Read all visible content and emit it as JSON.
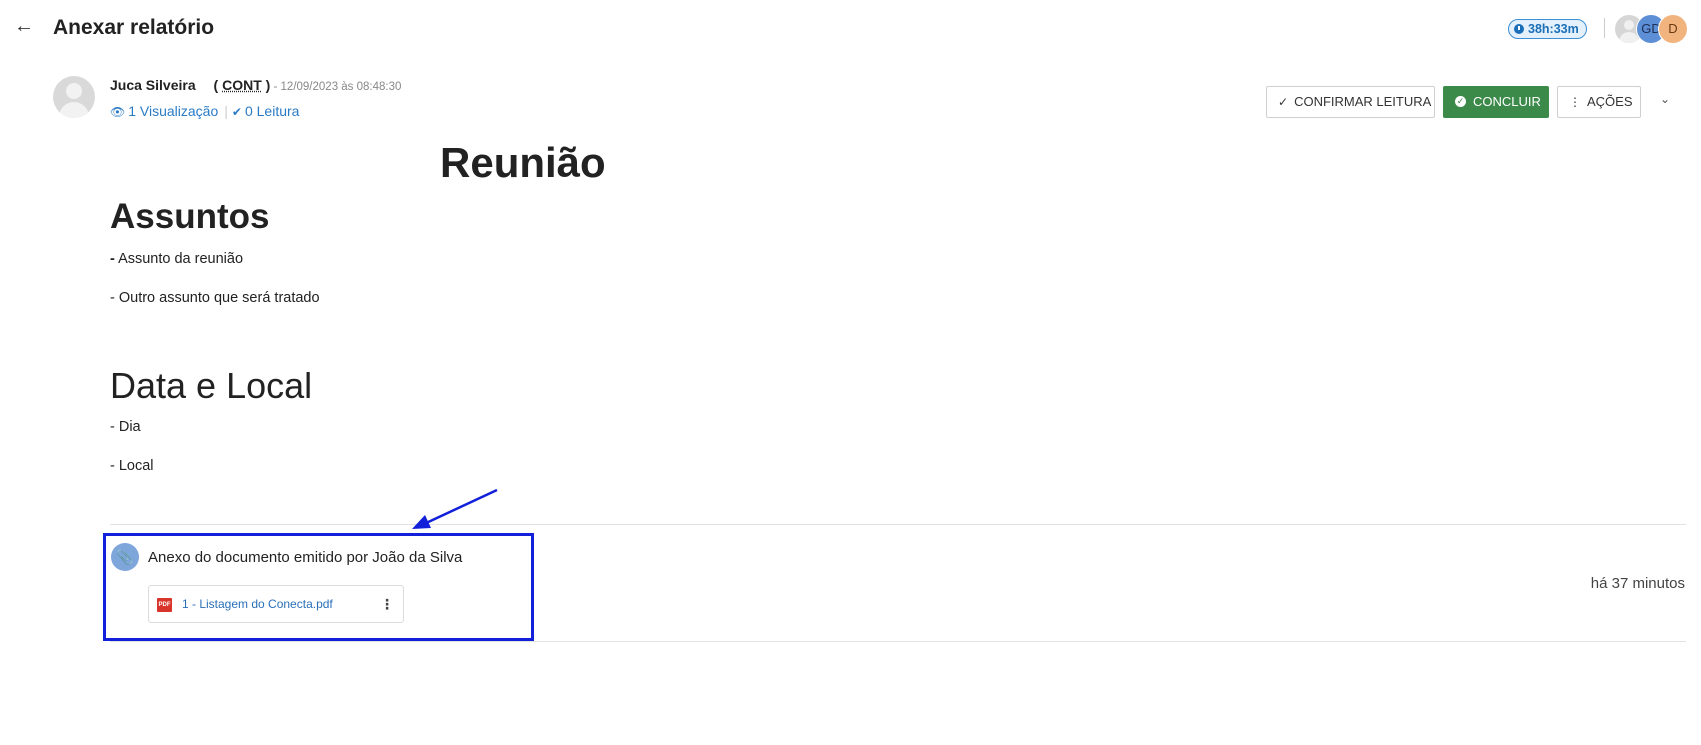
{
  "header": {
    "back_icon": "arrow-left-icon",
    "title": "Anexar relatório",
    "timer": "38h:33m",
    "avatars": [
      {
        "initials": ""
      },
      {
        "initials": "GD"
      },
      {
        "initials": "D"
      }
    ]
  },
  "author": {
    "name": "Juca Silveira",
    "dept_open": "( ",
    "dept_code": "CONT",
    "dept_close": " )",
    "date": " - 12/09/2023 às 08:48:30",
    "views": "1 Visualização",
    "reads": "0 Leitura"
  },
  "actions": {
    "confirm": "CONFIRMAR LEITURA",
    "concluir": "CONCLUIR",
    "acoes": "AÇÕES",
    "check_glyph": "✓",
    "kebab_glyph": "⋮",
    "chevron_glyph": "⌄"
  },
  "document": {
    "title": "Reunião",
    "section1_heading": "Assuntos",
    "section1_item1_dash": "-",
    "section1_item1": " Assunto da reunião",
    "section1_item2": "- Outro assunto que será tratado",
    "section2_heading": "Data e Local",
    "section2_item1": "- Dia",
    "section2_item2": "- Local"
  },
  "attachment": {
    "text": "Anexo do documento emitido por João da Silva",
    "file_name": "1 - Listagem do Conecta.pdf",
    "file_type": "PDF",
    "time_ago": "há 37 minutos"
  },
  "colors": {
    "accent_blue": "#2a7bc6",
    "success_green": "#3b8a4a",
    "highlight_box": "#1220d9",
    "pdf_red": "#d9342b"
  }
}
